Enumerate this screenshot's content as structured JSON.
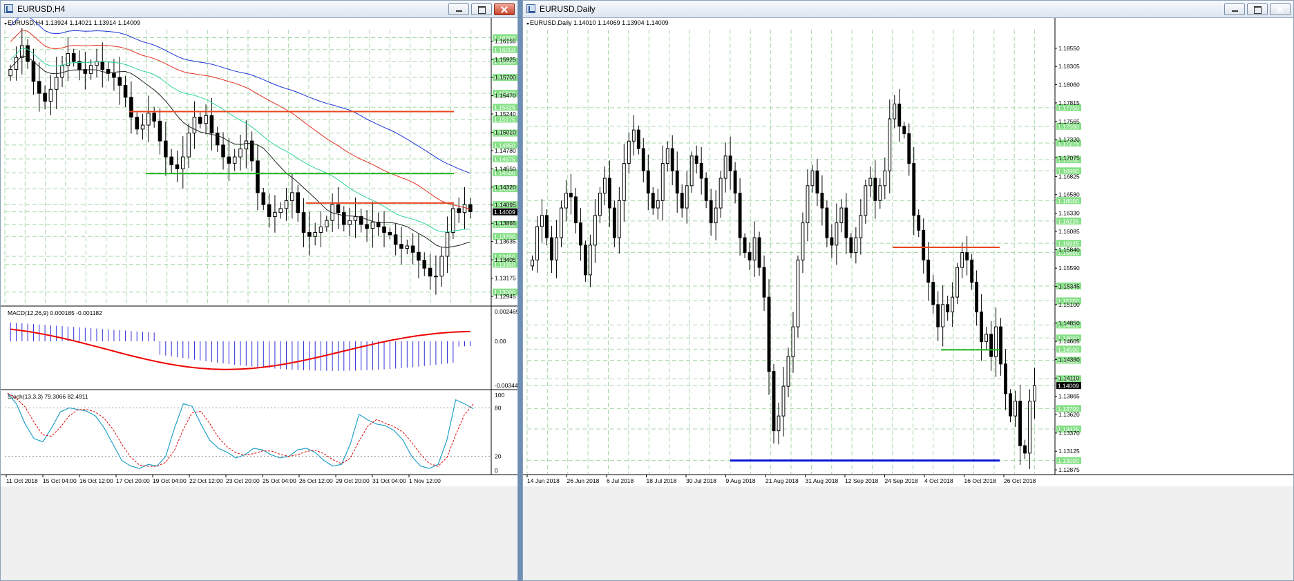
{
  "windows": {
    "h4": {
      "title": "EURUSD,H4",
      "info": "EURUSD,H4  1.13924 1.14021 1.13914 1.14009",
      "macd_label": "MACD(12,26,9) 0.000185 -0.001182",
      "stoch_label": "Stoch(13,3,3) 79.3066 82.4911"
    },
    "daily": {
      "title": "EURUSD,Daily",
      "info": "EURUSD,Daily  1.14010 1.14069 1.13904 1.14009"
    }
  },
  "colors": {
    "bull": "#ffffff",
    "bear": "#000000",
    "grid": "#a7d7a7",
    "red_line": "#e8451e",
    "green_line": "#23b623",
    "blue_line": "#0a14d6",
    "ma_blue": "#1a34d8",
    "ma_red": "#e03020",
    "ma_green": "#2fd39a",
    "ma_black": "#222222",
    "macd_hist": "#2b2bd8",
    "macd_signal": "#ee0000",
    "stoch_main": "#22a0c8",
    "stoch_signal": "#dd0000",
    "price_tag_bg": "#86e086"
  },
  "chart_data": [
    {
      "id": "h4",
      "type": "candlestick",
      "title": "EURUSD,H4",
      "ylim": [
        1.1285,
        1.163
      ],
      "y_ticks": [
        "1.16155",
        "1.15925",
        "1.15700",
        "1.15470",
        "1.15240",
        "1.15010",
        "1.14780",
        "1.14550",
        "1.14320",
        "1.14095",
        "1.13865",
        "1.13635",
        "1.13405",
        "1.13175",
        "1.12945"
      ],
      "level_tags": [
        "1.16200",
        "1.16050",
        "1.15900",
        "1.15700",
        "1.15500",
        "1.15325",
        "1.15175",
        "1.15000",
        "1.14850",
        "1.14675",
        "1.14500",
        "1.14300",
        "1.14100",
        "1.14009",
        "1.13850",
        "1.13700",
        "1.13450",
        "1.13350",
        "1.13000"
      ],
      "x_ticks": [
        "11 Oct 2018",
        "15 Oct 04:00",
        "16 Oct 12:00",
        "17 Oct 20:00",
        "19 Oct 04:00",
        "22 Oct 12:00",
        "23 Oct 20:00",
        "25 Oct 04:00",
        "26 Oct 12:00",
        "29 Oct 20:00",
        "31 Oct 04:00",
        "1 Nov 12:00"
      ],
      "close_series": [
        1.158,
        1.1595,
        1.161,
        1.159,
        1.1565,
        1.155,
        1.154,
        1.1555,
        1.157,
        1.1585,
        1.16,
        1.159,
        1.158,
        1.1575,
        1.1585,
        1.159,
        1.158,
        1.1575,
        1.157,
        1.156,
        1.1545,
        1.152,
        1.1505,
        1.151,
        1.1525,
        1.1515,
        1.149,
        1.147,
        1.146,
        1.1455,
        1.147,
        1.15,
        1.152,
        1.1512,
        1.1522,
        1.15,
        1.1485,
        1.147,
        1.1462,
        1.147,
        1.148,
        1.149,
        1.1465,
        1.1425,
        1.141,
        1.1395,
        1.14,
        1.1405,
        1.1415,
        1.1425,
        1.14,
        1.1375,
        1.137,
        1.1375,
        1.1382,
        1.139,
        1.141,
        1.14,
        1.1385,
        1.139,
        1.1395,
        1.1385,
        1.138,
        1.1388,
        1.1382,
        1.1375,
        1.1372,
        1.136,
        1.1355,
        1.1358,
        1.135,
        1.134,
        1.133,
        1.132,
        1.132,
        1.1345,
        1.1375,
        1.1405,
        1.14,
        1.141,
        1.1401
      ],
      "horizontal_levels": [
        {
          "price": 1.1527,
          "color": "red"
        },
        {
          "price": 1.1449,
          "color": "green"
        },
        {
          "price": 1.1412,
          "color": "red"
        }
      ],
      "moving_averages": [
        "blue",
        "red",
        "green",
        "black"
      ]
    },
    {
      "id": "h4_macd",
      "type": "bar",
      "title": "MACD(12,26,9) 0.000185 -0.001182",
      "ylim": [
        -0.003442,
        0.002469
      ],
      "y_ticks": [
        "0.002469",
        "0.00",
        "-0.003442"
      ],
      "main": 0.000185,
      "signal": -0.001182
    },
    {
      "id": "h4_stoch",
      "type": "line",
      "title": "Stoch(13,3,3) 79.3066 82.4911",
      "ylim": [
        0,
        100
      ],
      "y_ticks": [
        "100",
        "80",
        "20",
        "0"
      ],
      "main": 79.3066,
      "signal": 82.4911,
      "main_series": [
        98,
        85,
        60,
        42,
        38,
        55,
        75,
        80,
        78,
        76,
        70,
        55,
        35,
        15,
        8,
        5,
        10,
        8,
        20,
        55,
        85,
        82,
        60,
        40,
        30,
        25,
        18,
        22,
        30,
        28,
        22,
        18,
        20,
        28,
        30,
        25,
        15,
        8,
        10,
        35,
        72,
        65,
        60,
        58,
        52,
        40,
        20,
        8,
        5,
        10,
        40,
        90,
        85,
        79
      ]
    },
    {
      "id": "daily",
      "type": "candlestick",
      "title": "EURUSD,Daily",
      "ylim": [
        1.1282,
        1.188
      ],
      "y_ticks": [
        "1.18550",
        "1.18305",
        "1.18060",
        "1.17815",
        "1.17565",
        "1.17320",
        "1.17075",
        "1.16825",
        "1.16580",
        "1.16330",
        "1.16085",
        "1.15840",
        "1.15590",
        "1.15345",
        "1.15100",
        "1.14850",
        "1.14605",
        "1.14360",
        "1.14110",
        "1.13865",
        "1.13620",
        "1.13370",
        "1.13125",
        "1.12875"
      ],
      "level_tags": [
        "1.17750",
        "1.17500",
        "1.17275",
        "1.17050",
        "1.16900",
        "1.16500",
        "1.16225",
        "1.15925",
        "1.15800",
        "1.15350",
        "1.15150",
        "1.14825",
        "1.14650",
        "1.14500",
        "1.14350",
        "1.14100",
        "1.14009",
        "1.13700",
        "1.13425",
        "1.13000"
      ],
      "x_ticks": [
        "14 Jun 2018",
        "26 Jun 2018",
        "6 Jul 2018",
        "18 Jul 2018",
        "30 Jul 2018",
        "9 Aug 2018",
        "21 Aug 2018",
        "31 Aug 2018",
        "12 Sep 2018",
        "24 Sep 2018",
        "4 Oct 2018",
        "16 Oct 2018",
        "26 Oct 2018"
      ],
      "close_series": [
        1.157,
        1.1615,
        1.163,
        1.16,
        1.157,
        1.16,
        1.164,
        1.166,
        1.1655,
        1.162,
        1.159,
        1.155,
        1.159,
        1.163,
        1.166,
        1.168,
        1.164,
        1.16,
        1.165,
        1.17,
        1.173,
        1.1745,
        1.172,
        1.169,
        1.166,
        1.164,
        1.165,
        1.17,
        1.172,
        1.169,
        1.166,
        1.164,
        1.167,
        1.171,
        1.17,
        1.168,
        1.165,
        1.162,
        1.164,
        1.168,
        1.171,
        1.169,
        1.166,
        1.16,
        1.158,
        1.157,
        1.16,
        1.156,
        1.152,
        1.142,
        1.134,
        1.136,
        1.14,
        1.144,
        1.148,
        1.157,
        1.162,
        1.167,
        1.169,
        1.166,
        1.164,
        1.16,
        1.159,
        1.162,
        1.164,
        1.16,
        1.158,
        1.16,
        1.163,
        1.167,
        1.168,
        1.165,
        1.167,
        1.169,
        1.176,
        1.178,
        1.175,
        1.174,
        1.17,
        1.163,
        1.161,
        1.157,
        1.154,
        1.151,
        1.148,
        1.151,
        1.15,
        1.152,
        1.156,
        1.158,
        1.157,
        1.154,
        1.15,
        1.146,
        1.147,
        1.144,
        1.148,
        1.143,
        1.139,
        1.136,
        1.138,
        1.132,
        1.131,
        1.138,
        1.1401
      ],
      "horizontal_levels": [
        {
          "price": 1.1587,
          "color": "red"
        },
        {
          "price": 1.1449,
          "color": "green"
        },
        {
          "price": 1.13,
          "color": "blue"
        }
      ]
    }
  ]
}
